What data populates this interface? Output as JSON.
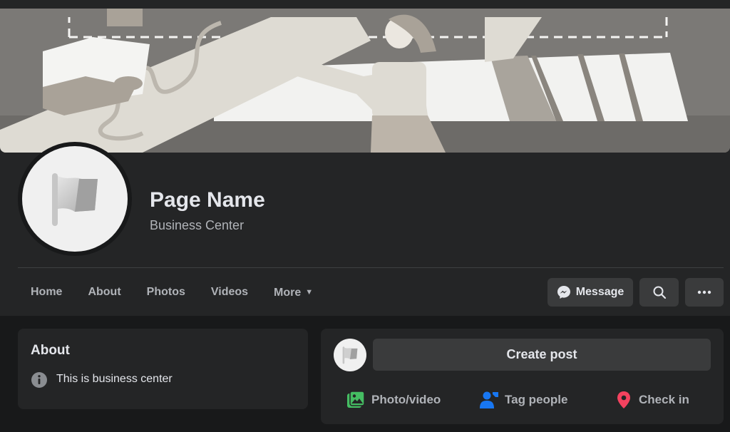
{
  "page": {
    "name": "Page Name",
    "category": "Business Center"
  },
  "nav": {
    "tabs": [
      {
        "label": "Home"
      },
      {
        "label": "About"
      },
      {
        "label": "Photos"
      },
      {
        "label": "Videos"
      },
      {
        "label": "More"
      }
    ]
  },
  "actions": {
    "message_label": "Message"
  },
  "about": {
    "title": "About",
    "description": "This is business center"
  },
  "composer": {
    "create_post_label": "Create post",
    "photo_video_label": "Photo/video",
    "tag_people_label": "Tag people",
    "check_in_label": "Check in"
  },
  "icons": {
    "flag": "flag-icon",
    "messenger": "messenger-icon",
    "search": "search-icon",
    "more": "ellipsis-icon",
    "info": "info-icon",
    "photo": "photo-icon",
    "tag": "tag-people-icon",
    "checkin": "location-pin-icon",
    "dropdown": "caret-down-icon"
  },
  "colors": {
    "background": "#18191a",
    "surface": "#242526",
    "button": "#3a3b3c",
    "photo_green": "#45bd62",
    "tag_blue": "#1877f2",
    "checkin_red": "#f3425f"
  }
}
